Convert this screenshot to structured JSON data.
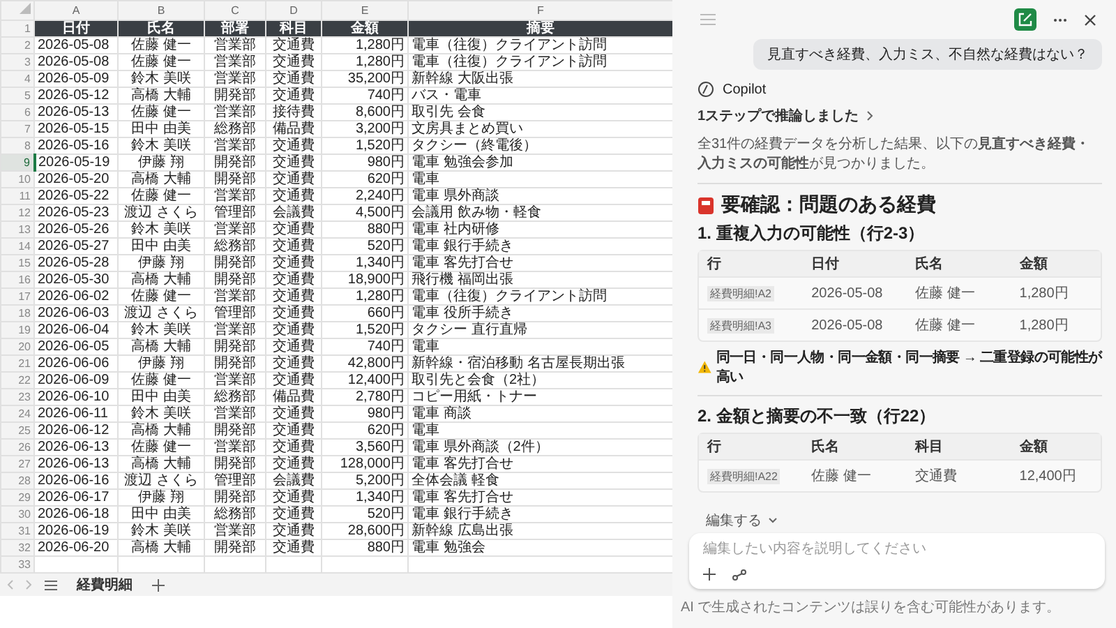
{
  "sheet": {
    "column_letters": [
      "A",
      "B",
      "C",
      "D",
      "E",
      "F"
    ],
    "header_row": {
      "number": "1",
      "cells": [
        "日付",
        "氏名",
        "部署",
        "科目",
        "金額",
        "摘要"
      ]
    },
    "rows": [
      {
        "number": "2",
        "selected": false,
        "cells": [
          "2026-05-08",
          "佐藤 健一",
          "営業部",
          "交通費",
          "1,280円",
          "電車（往復）クライアント訪問"
        ]
      },
      {
        "number": "3",
        "selected": false,
        "cells": [
          "2026-05-08",
          "佐藤 健一",
          "営業部",
          "交通費",
          "1,280円",
          "電車（往復）クライアント訪問"
        ]
      },
      {
        "number": "4",
        "selected": false,
        "cells": [
          "2026-05-09",
          "鈴木 美咲",
          "営業部",
          "交通費",
          "35,200円",
          "新幹線 大阪出張"
        ]
      },
      {
        "number": "5",
        "selected": false,
        "cells": [
          "2026-05-12",
          "高橋 大輔",
          "開発部",
          "交通費",
          "740円",
          "バス・電車"
        ]
      },
      {
        "number": "6",
        "selected": false,
        "cells": [
          "2026-05-13",
          "佐藤 健一",
          "営業部",
          "接待費",
          "8,600円",
          "取引先 会食"
        ]
      },
      {
        "number": "7",
        "selected": false,
        "cells": [
          "2026-05-15",
          "田中 由美",
          "総務部",
          "備品費",
          "3,200円",
          "文房具まとめ買い"
        ]
      },
      {
        "number": "8",
        "selected": false,
        "cells": [
          "2026-05-16",
          "鈴木 美咲",
          "営業部",
          "交通費",
          "1,520円",
          "タクシー（終電後）"
        ]
      },
      {
        "number": "9",
        "selected": true,
        "cells": [
          "2026-05-19",
          "伊藤 翔",
          "開発部",
          "交通費",
          "980円",
          "電車 勉強会参加"
        ]
      },
      {
        "number": "10",
        "selected": false,
        "cells": [
          "2026-05-20",
          "高橋 大輔",
          "開発部",
          "交通費",
          "620円",
          "電車"
        ]
      },
      {
        "number": "11",
        "selected": false,
        "cells": [
          "2026-05-22",
          "佐藤 健一",
          "営業部",
          "交通費",
          "2,240円",
          "電車 県外商談"
        ]
      },
      {
        "number": "12",
        "selected": false,
        "cells": [
          "2026-05-23",
          "渡辺 さくら",
          "管理部",
          "会議費",
          "4,500円",
          "会議用 飲み物・軽食"
        ]
      },
      {
        "number": "13",
        "selected": false,
        "cells": [
          "2026-05-26",
          "鈴木 美咲",
          "営業部",
          "交通費",
          "880円",
          "電車 社内研修"
        ]
      },
      {
        "number": "14",
        "selected": false,
        "cells": [
          "2026-05-27",
          "田中 由美",
          "総務部",
          "交通費",
          "520円",
          "電車 銀行手続き"
        ]
      },
      {
        "number": "15",
        "selected": false,
        "cells": [
          "2026-05-28",
          "伊藤 翔",
          "開発部",
          "交通費",
          "1,340円",
          "電車 客先打合せ"
        ]
      },
      {
        "number": "16",
        "selected": false,
        "cells": [
          "2026-05-30",
          "高橋 大輔",
          "開発部",
          "交通費",
          "18,900円",
          "飛行機 福岡出張"
        ]
      },
      {
        "number": "17",
        "selected": false,
        "cells": [
          "2026-06-02",
          "佐藤 健一",
          "営業部",
          "交通費",
          "1,280円",
          "電車（往復）クライアント訪問"
        ]
      },
      {
        "number": "18",
        "selected": false,
        "cells": [
          "2026-06-03",
          "渡辺 さくら",
          "管理部",
          "交通費",
          "660円",
          "電車 役所手続き"
        ]
      },
      {
        "number": "19",
        "selected": false,
        "cells": [
          "2026-06-04",
          "鈴木 美咲",
          "営業部",
          "交通費",
          "1,520円",
          "タクシー 直行直帰"
        ]
      },
      {
        "number": "20",
        "selected": false,
        "cells": [
          "2026-06-05",
          "高橋 大輔",
          "開発部",
          "交通費",
          "740円",
          "電車"
        ]
      },
      {
        "number": "21",
        "selected": false,
        "cells": [
          "2026-06-06",
          "伊藤 翔",
          "開発部",
          "交通費",
          "42,800円",
          "新幹線・宿泊移動 名古屋長期出張"
        ]
      },
      {
        "number": "22",
        "selected": false,
        "cells": [
          "2026-06-09",
          "佐藤 健一",
          "営業部",
          "交通費",
          "12,400円",
          "取引先と会食（2社）"
        ]
      },
      {
        "number": "23",
        "selected": false,
        "cells": [
          "2026-06-10",
          "田中 由美",
          "総務部",
          "備品費",
          "2,780円",
          "コピー用紙・トナー"
        ]
      },
      {
        "number": "24",
        "selected": false,
        "cells": [
          "2026-06-11",
          "鈴木 美咲",
          "営業部",
          "交通費",
          "980円",
          "電車 商談"
        ]
      },
      {
        "number": "25",
        "selected": false,
        "cells": [
          "2026-06-12",
          "高橋 大輔",
          "開発部",
          "交通費",
          "620円",
          "電車"
        ]
      },
      {
        "number": "26",
        "selected": false,
        "cells": [
          "2026-06-13",
          "佐藤 健一",
          "営業部",
          "交通費",
          "3,560円",
          "電車 県外商談（2件）"
        ]
      },
      {
        "number": "27",
        "selected": false,
        "cells": [
          "2026-06-13",
          "高橋 大輔",
          "開発部",
          "交通費",
          "128,000円",
          "電車 客先打合せ"
        ]
      },
      {
        "number": "28",
        "selected": false,
        "cells": [
          "2026-06-16",
          "渡辺 さくら",
          "管理部",
          "会議費",
          "5,200円",
          "全体会議 軽食"
        ]
      },
      {
        "number": "29",
        "selected": false,
        "cells": [
          "2026-06-17",
          "伊藤 翔",
          "開発部",
          "交通費",
          "1,340円",
          "電車 客先打合せ"
        ]
      },
      {
        "number": "30",
        "selected": false,
        "cells": [
          "2026-06-18",
          "田中 由美",
          "総務部",
          "交通費",
          "520円",
          "電車 銀行手続き"
        ]
      },
      {
        "number": "31",
        "selected": false,
        "cells": [
          "2026-06-19",
          "鈴木 美咲",
          "営業部",
          "交通費",
          "28,600円",
          "新幹線 広島出張"
        ]
      },
      {
        "number": "32",
        "selected": false,
        "cells": [
          "2026-06-20",
          "高橋 大輔",
          "開発部",
          "交通費",
          "880円",
          "電車 勉強会"
        ]
      },
      {
        "number": "33",
        "selected": false,
        "cells": []
      }
    ],
    "sheet_tabs": [
      {
        "label": "経費明細",
        "selected": true
      }
    ]
  },
  "copilot": {
    "user_message": "見直すべき経費、入力ミス、不自然な経費はない？",
    "assistant_name": "Copilot",
    "reasoning": "1ステップで推論しました",
    "intro": "全31件の経費データを分析した結果、以下の**見直すべき経費・入力ミスの可能性**が見つかりました。",
    "heading": "要確認：問題のある経費",
    "sections": [
      {
        "title": "1. 重複入力の可能性（行2-3）",
        "columns": [
          "行",
          "日付",
          "氏名",
          "金額"
        ],
        "rows": [
          [
            "経費明細!A2",
            "2026-05-08",
            "佐藤 健一",
            "1,280円"
          ],
          [
            "経費明細!A3",
            "2026-05-08",
            "佐藤 健一",
            "1,280円"
          ]
        ],
        "warning": "同一日・同一人物・同一金額・同一摘要 → 二重登録の可能性が高い"
      },
      {
        "title": "2. 金額と摘要の不一致（行22）",
        "columns": [
          "行",
          "氏名",
          "科目",
          "金額"
        ],
        "rows": [
          [
            "経費明細!A22",
            "佐藤 健一",
            "交通費",
            "12,400円"
          ]
        ]
      }
    ],
    "edit_menu": "編集する",
    "input": {
      "placeholder": "編集したい内容を説明してください"
    },
    "disclaimer": "AI で生成されたコンテンツは誤りを含む可能性があります。"
  }
}
